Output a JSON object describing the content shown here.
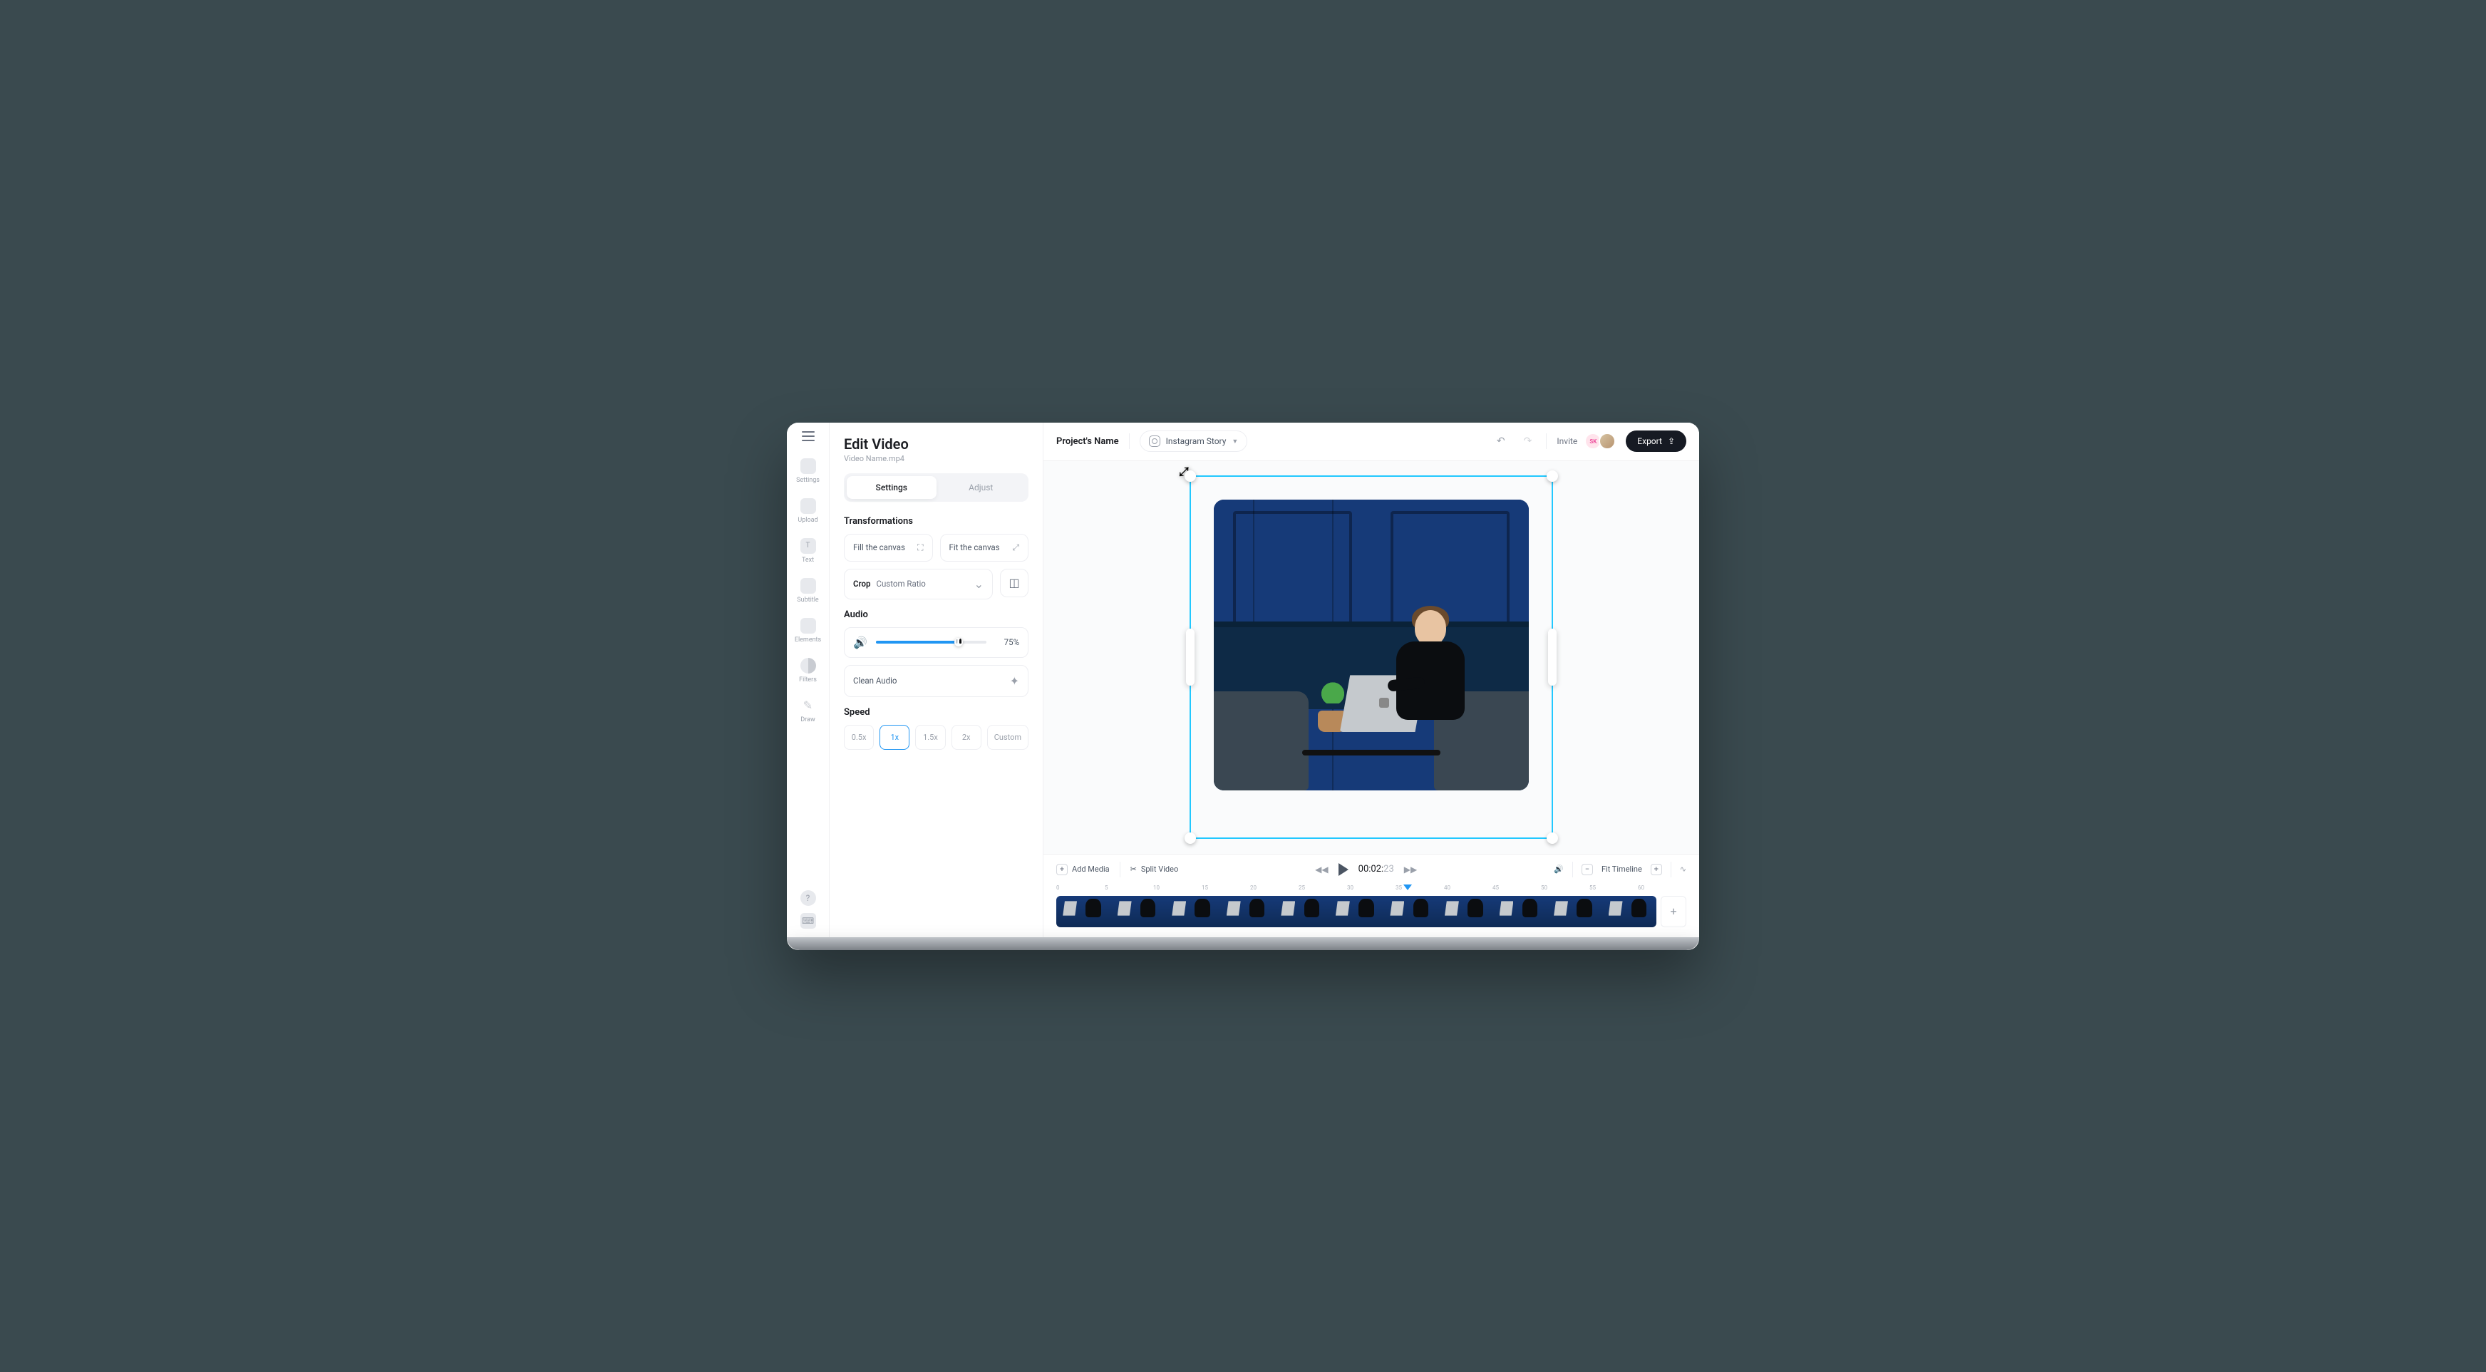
{
  "sidebar": {
    "items": [
      {
        "label": "Settings"
      },
      {
        "label": "Upload"
      },
      {
        "label": "Text"
      },
      {
        "label": "Subtitle"
      },
      {
        "label": "Elements"
      },
      {
        "label": "Filters"
      },
      {
        "label": "Draw"
      }
    ]
  },
  "panel": {
    "title": "Edit Video",
    "subtitle": "Video Name.mp4",
    "tabs": {
      "settings": "Settings",
      "adjust": "Adjust"
    },
    "transformations": {
      "heading": "Transformations",
      "fill": "Fill the canvas",
      "fit": "Fit the canvas",
      "crop_label": "Crop",
      "crop_value": "Custom Ratio"
    },
    "audio": {
      "heading": "Audio",
      "volume_pct": "75%",
      "clean": "Clean Audio"
    },
    "speed": {
      "heading": "Speed",
      "options": [
        "0.5x",
        "1x",
        "1.5x",
        "2x",
        "Custom"
      ],
      "active": "1x"
    }
  },
  "topbar": {
    "project": "Project's Name",
    "format": "Instagram Story",
    "invite": "Invite",
    "avatar_initials": "SK",
    "export": "Export"
  },
  "timeline": {
    "add_media": "Add Media",
    "split": "Split Video",
    "timecode_main": "00:02:",
    "timecode_frames": "23",
    "fit": "Fit Timeline",
    "ruler": [
      "0",
      "5",
      "10",
      "15",
      "20",
      "25",
      "30",
      "35",
      "40",
      "45",
      "50",
      "55",
      "60"
    ]
  }
}
